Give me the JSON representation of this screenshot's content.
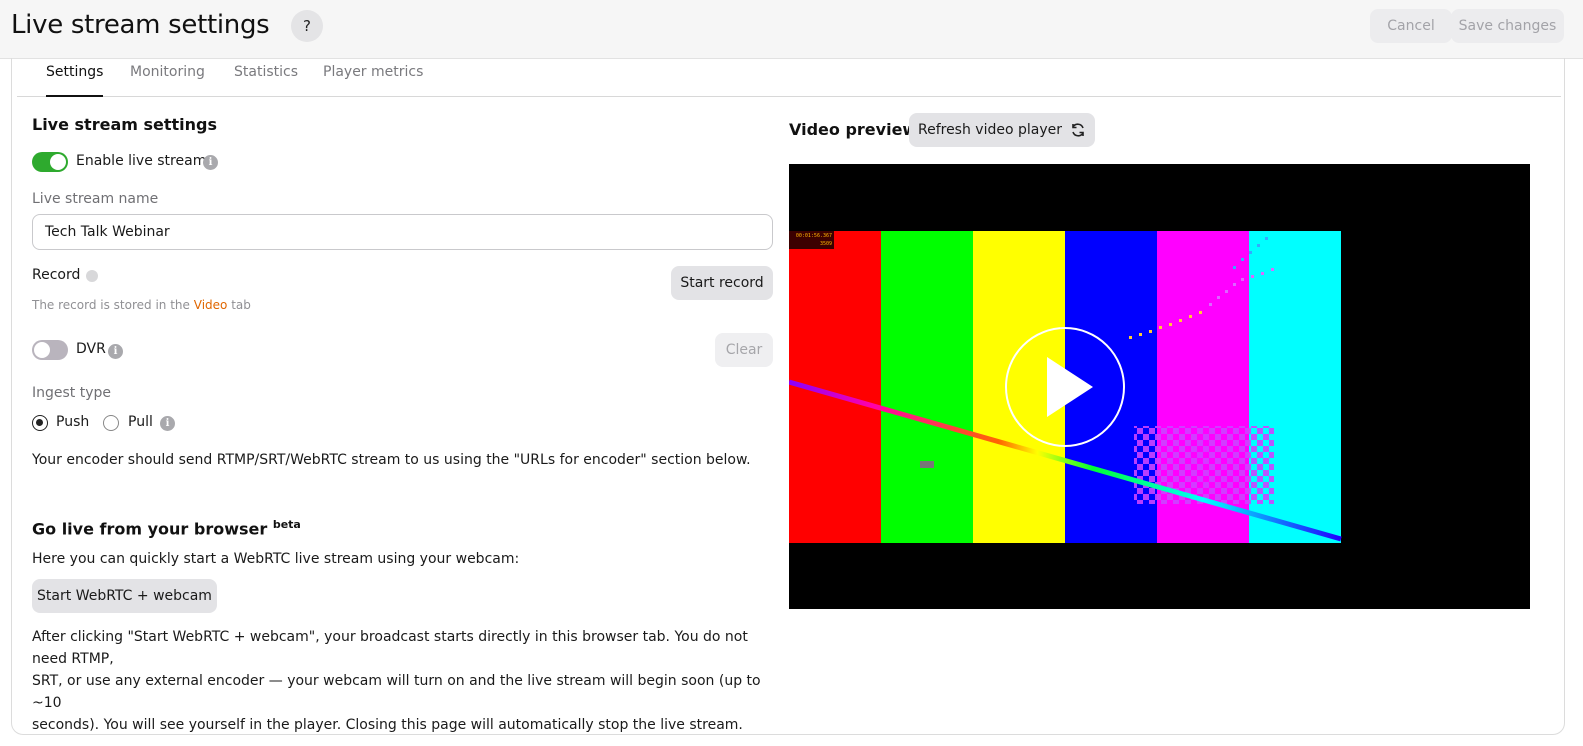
{
  "header": {
    "title": "Live stream settings",
    "help_label": "?",
    "cancel_label": "Cancel",
    "save_label": "Save changes"
  },
  "tabs": [
    {
      "label": "Settings",
      "active": true
    },
    {
      "label": "Monitoring",
      "active": false
    },
    {
      "label": "Statistics",
      "active": false
    },
    {
      "label": "Player metrics",
      "active": false
    }
  ],
  "settings": {
    "section_title": "Live stream settings",
    "enable_label": "Enable live stream",
    "enable_on": true,
    "name_label": "Live stream name",
    "name_value": "Tech Talk Webinar",
    "record_label": "Record",
    "start_record_label": "Start record",
    "record_note_prefix": "The record is stored in the",
    "record_note_link": "Video",
    "record_note_suffix": "tab",
    "dvr_label": "DVR",
    "dvr_on": false,
    "clear_label": "Clear",
    "ingest_label": "Ingest type",
    "ingest_options": [
      {
        "label": "Push",
        "checked": true
      },
      {
        "label": "Pull",
        "checked": false
      }
    ],
    "ingest_note": "Your encoder should send RTMP/SRT/WebRTC stream to us using the \"URLs for encoder\" section below."
  },
  "browser_live": {
    "title": "Go live from your browser",
    "badge": "beta",
    "intro": "Here you can quickly start a WebRTC live stream using your webcam:",
    "button_label": "Start WebRTC + webcam",
    "description_lines": [
      "After clicking \"Start WebRTC + webcam\", your broadcast starts directly in this browser tab. You do not need RTMP,",
      "SRT, or use any external encoder — your webcam will turn on and the live stream will begin soon (up to ~10",
      "seconds). You will see yourself in the player. Closing this page will automatically stop the live stream."
    ]
  },
  "preview": {
    "title": "Video preview",
    "refresh_label": "Refresh video player",
    "timecode_line1": "00:01:56.367",
    "timecode_line2": "3509",
    "bar_colors": [
      "#ff0000",
      "#00ff00",
      "#ffff00",
      "#0000ff",
      "#ff00ff",
      "#00ffff"
    ]
  },
  "icons": {
    "info": "info-icon",
    "refresh": "refresh-icon",
    "play": "play-icon"
  }
}
